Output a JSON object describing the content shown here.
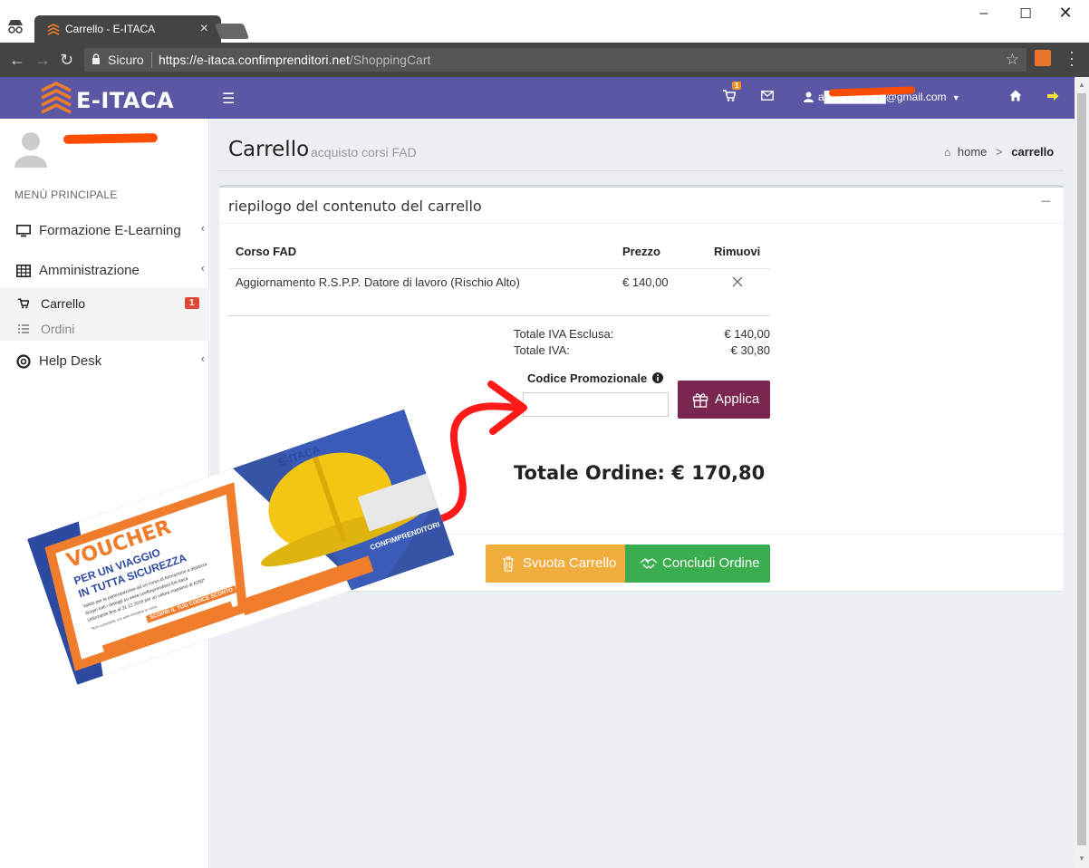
{
  "browser": {
    "tab_title": "Carrello - E-ITACA",
    "secure_label": "Sicuro",
    "url_main": "https://e-itaca.confimprenditori.net",
    "url_path": "/ShoppingCart"
  },
  "header": {
    "logo_text": "E-ITACA",
    "cart_count": "1",
    "user_email": "a████████@gmail.com"
  },
  "sidebar": {
    "menu_header": "MENÙ PRINCIPALE",
    "items": [
      {
        "label": "Formazione E-Learning"
      },
      {
        "label": "Amministrazione"
      },
      {
        "label": "Help Desk"
      }
    ],
    "subitems": [
      {
        "label": "Carrello",
        "badge": "1"
      },
      {
        "label": "Ordini"
      }
    ]
  },
  "page": {
    "title": "Carrello",
    "subtitle": "acquisto corsi FAD",
    "breadcrumb_home": "home",
    "breadcrumb_sep": ">",
    "breadcrumb_current": "carrello"
  },
  "cart": {
    "box_title": "riepilogo del contenuto del carrello",
    "columns": [
      "Corso FAD",
      "Prezzo",
      "Rimuovi"
    ],
    "rows": [
      {
        "course": "Aggiornamento R.S.P.P. Datore di lavoro (Rischio Alto)",
        "price": "€ 140,00"
      }
    ],
    "subtotal_label": "Totale IVA Esclusa:",
    "subtotal_value": "€ 140,00",
    "vat_label": "Totale IVA:",
    "vat_value": "€ 30,80",
    "promo_label": "Codice Promozionale",
    "promo_value": "",
    "apply_label": "Applica",
    "total_label": "Totale Ordine: € 170,80",
    "empty_label": "Svuota Carrello",
    "conclude_label": "Concludi Ordine"
  },
  "voucher": {
    "brand": "E-ITACA",
    "title": "VOUCHER",
    "subtitle_1": "PER UN VIAGGIO",
    "subtitle_2": "IN TUTTA SICUREZZA",
    "body_1": "Valido per la partecipazione ad un corso di formazione a distanza",
    "body_2": "Scopri tutti i dettagli su www.confimprenditori.it/e-itaca",
    "body_3": "Utilizzabile fino al 31.12.2018 per un valore massimo di €250*",
    "footnote": "*Non cumulabile con altre iniziative in corso",
    "cta": "SCOPRI IL TUO CODICE SCONTO",
    "partner": "CONFIMPRENDITORI"
  },
  "colors": {
    "header_bg": "#5b57a4",
    "apply_btn": "#7a2650",
    "empty_btn": "#f0ad3e",
    "conclude_btn": "#3aad4f",
    "badge_red": "#dd4b39",
    "arrow_red": "#ff1a1a",
    "brand_orange": "#f07d2c"
  },
  "icons": {
    "incognito": "incognito-icon",
    "cart": "shopping-cart-icon",
    "mail": "envelope-icon",
    "user": "user-icon",
    "home": "home-icon",
    "logout": "sign-out-icon",
    "monitor": "desktop-icon",
    "admin": "table-icon",
    "help": "life-ring-icon",
    "gift": "gift-icon",
    "trash": "trash-icon",
    "handshake": "handshake-icon",
    "info": "info-circle-icon"
  }
}
